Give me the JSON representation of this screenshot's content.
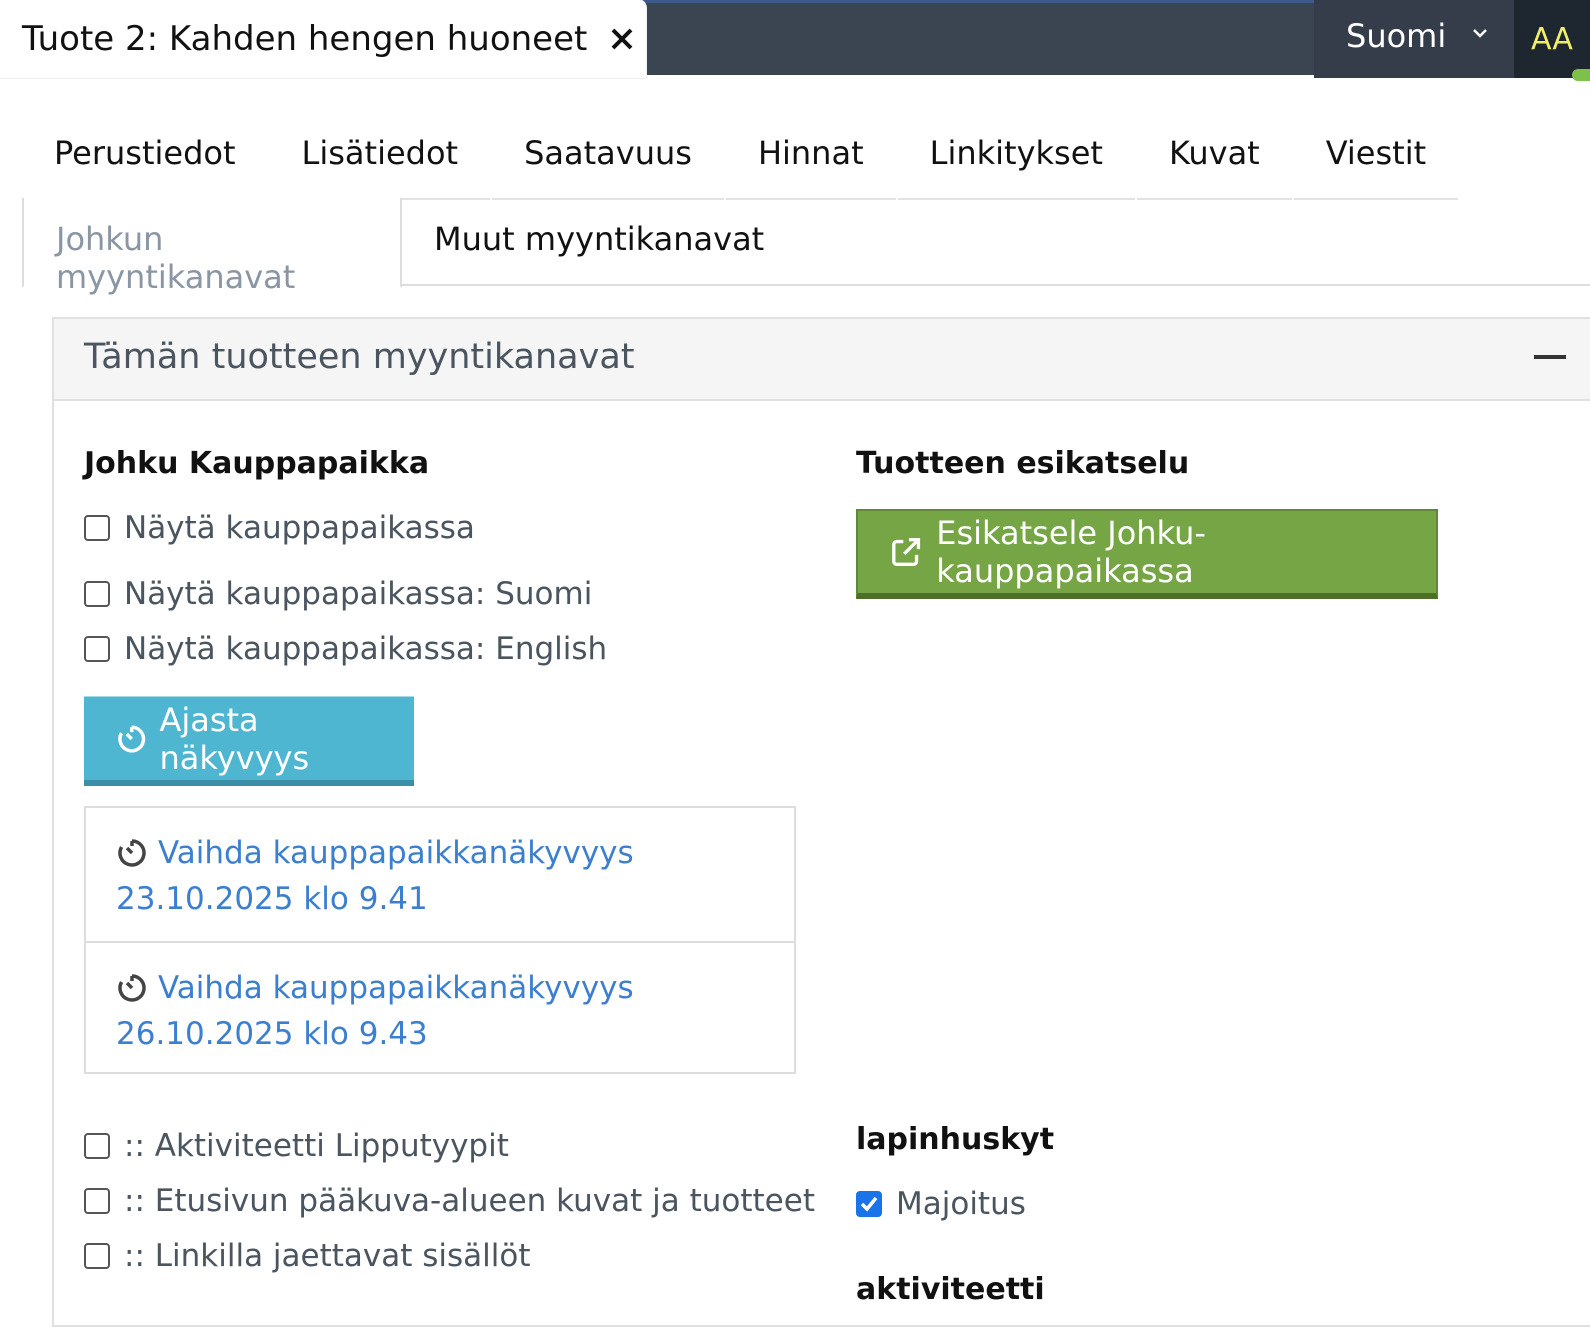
{
  "topbar": {
    "language": "Suomi",
    "avatar_initials": "AA",
    "colors": {
      "bar": "#3b4451",
      "avatar_text": "#f1ee6a"
    }
  },
  "doc_tab": {
    "title": "Tuote 2: Kahden hengen huoneet"
  },
  "main_tabs": [
    "Perustiedot",
    "Lisätiedot",
    "Saatavuus",
    "Hinnat",
    "Linkitykset",
    "Kuvat",
    "Viestit"
  ],
  "sub_tabs": {
    "active": "Johkun myyntikanavat",
    "other": "Muut myyntikanavat"
  },
  "panel": {
    "title": "Tämän tuotteen myyntikanavat",
    "marketplace": {
      "heading": "Johku Kauppapaikka",
      "options": [
        {
          "label": "Näytä kauppapaikassa",
          "checked": false
        },
        {
          "label": "Näytä kauppapaikassa: Suomi",
          "checked": false
        },
        {
          "label": "Näytä kauppapaikassa: English",
          "checked": false
        }
      ],
      "schedule_button": "Ajasta näkyvyys",
      "schedules": [
        {
          "label": "Vaihda kauppapaikkanäkyvyys",
          "when": "23.10.2025 klo 9.41"
        },
        {
          "label": "Vaihda kauppapaikkanäkyvyys",
          "when": "26.10.2025 klo 9.43"
        }
      ]
    },
    "preview": {
      "heading": "Tuotteen esikatselu",
      "button": "Esikatsele Johku-kauppapaikassa"
    },
    "categories": [
      {
        "label": ":: Aktiviteetti Lipputyypit",
        "checked": false
      },
      {
        "label": ":: Etusivun pääkuva-alueen kuvat ja tuotteet",
        "checked": false
      },
      {
        "label": ":: Linkilla jaettavat sisällöt",
        "checked": false
      }
    ],
    "groups": {
      "first_heading": "lapinhuskyt",
      "first_option": {
        "label": "Majoitus",
        "checked": true
      },
      "second_heading": "aktiviteetti"
    }
  }
}
